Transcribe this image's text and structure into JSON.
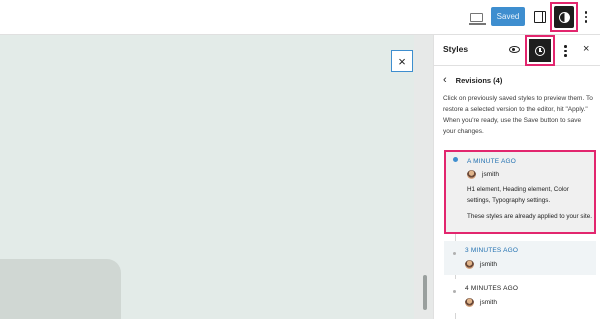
{
  "topbar": {
    "save_label": "Saved",
    "colors": {
      "save_bg": "#3e8ecf",
      "highlight": "#e2266e"
    },
    "icons": [
      "desktop-view-icon",
      "sidebar-toggle-icon",
      "styles-contrast-icon",
      "options-kebab-icon"
    ]
  },
  "canvas": {
    "close_symbol": "×",
    "colors": {
      "preview_bg": "#e3ebe8",
      "card": "#d0d7d3"
    }
  },
  "sidebar": {
    "title": "Styles",
    "close_symbol": "×",
    "icons": [
      "eye-icon",
      "revisions-clock-icon",
      "kebab-icon",
      "close-icon"
    ],
    "revisions": {
      "back_symbol": "‹",
      "title": "Revisions (4)",
      "description": "Click on previously saved styles to preview them. To restore a selected version to the editor, hit \"Apply.\" When you're ready, use the Save button to save your changes.",
      "items": [
        {
          "date": "A MINUTE AGO",
          "author": "jsmith",
          "summary": "H1 element, Heading element, Color settings, Typography settings.",
          "note": "These styles are already applied to your site."
        },
        {
          "date": "3 MINUTES AGO",
          "author": "jsmith"
        },
        {
          "date": "4 MINUTES AGO",
          "author": "jsmith"
        }
      ]
    }
  }
}
